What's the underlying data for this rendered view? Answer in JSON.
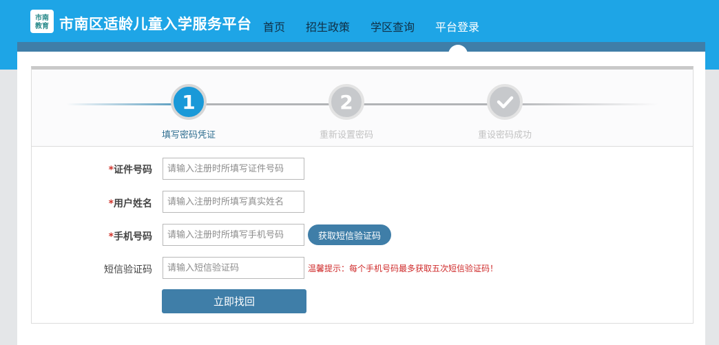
{
  "header": {
    "logo_text": "市南教育",
    "site_title": "市南区适龄儿童入学服务平台",
    "nav": [
      "首页",
      "招生政策",
      "学区查询",
      "平台登录"
    ],
    "active_nav": "平台登录"
  },
  "steps": [
    {
      "number": "1",
      "label": "填写密码凭证",
      "state": "active"
    },
    {
      "number": "2",
      "label": "重新设置密码",
      "state": "pending"
    },
    {
      "icon": "checkmark-icon",
      "label": "重设密码成功",
      "state": "pending"
    }
  ],
  "form": {
    "required_mark": "*",
    "id_label": "证件号码",
    "id_placeholder": "请输入注册时所填写证件号码",
    "name_label": "用户姓名",
    "name_placeholder": "请输入注册时所填写真实姓名",
    "phone_label": "手机号码",
    "phone_placeholder": "请输入注册时所填写手机号码",
    "sms_button": "获取短信验证码",
    "code_label": "短信验证码",
    "code_placeholder": "请输入短信验证码",
    "tip": "温馨提示：每个手机号码最多获取五次短信验证码！",
    "submit": "立即找回"
  },
  "colors": {
    "header": "#1ea5e6",
    "nav_bar": "#3f7ea8",
    "active_step": "#1a99d8",
    "button": "#3f7ea8",
    "tip_text": "#cf2a2a"
  }
}
